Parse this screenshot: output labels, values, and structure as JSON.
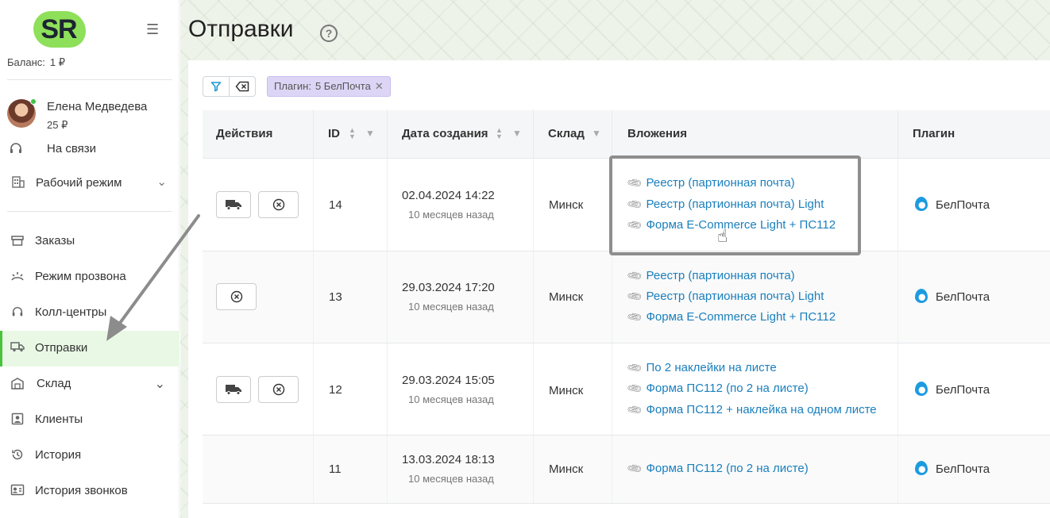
{
  "sidebar": {
    "logo_text": "SR",
    "balance_label": "Баланс:",
    "balance_value": "1 ₽",
    "user": {
      "name": "Елена Медведева",
      "amount": "25 ₽"
    },
    "status": "На связи",
    "mode": "Рабочий режим",
    "items": [
      {
        "label": "Заказы",
        "icon": "orders-icon"
      },
      {
        "label": "Режим прозвона",
        "icon": "dial-mode-icon"
      },
      {
        "label": "Колл-центры",
        "icon": "headset-icon"
      },
      {
        "label": "Отправки",
        "icon": "truck-icon",
        "active": true
      },
      {
        "label": "Склад",
        "icon": "warehouse-icon"
      },
      {
        "label": "Клиенты",
        "icon": "clients-icon"
      },
      {
        "label": "История",
        "icon": "history-icon"
      },
      {
        "label": "История звонков",
        "icon": "call-history-icon"
      }
    ]
  },
  "page": {
    "title": "Отправки",
    "help": "?"
  },
  "filter_chip": {
    "label": "Плагин:",
    "value": "5 БелПочта"
  },
  "table": {
    "columns": [
      "Действия",
      "ID",
      "Дата создания",
      "Склад",
      "Вложения",
      "Плагин"
    ],
    "rows": [
      {
        "id": "14",
        "date": "02.04.2024 14:22",
        "ago": "10 месяцев назад",
        "warehouse": "Минск",
        "attachments": [
          "Реестр (партионная почта)",
          "Реестр (партионная почта) Light",
          "Форма E-Commerce Light + ПС112"
        ],
        "plugin": "БелПочта"
      },
      {
        "id": "13",
        "date": "29.03.2024 17:20",
        "ago": "10 месяцев назад",
        "warehouse": "Минск",
        "attachments": [
          "Реестр (партионная почта)",
          "Реестр (партионная почта) Light",
          "Форма E-Commerce Light + ПС112"
        ],
        "plugin": "БелПочта"
      },
      {
        "id": "12",
        "date": "29.03.2024 15:05",
        "ago": "10 месяцев назад",
        "warehouse": "Минск",
        "attachments": [
          "По 2 наклейки на листе",
          "Форма ПС112 (по 2 на листе)",
          "Форма ПС112 + наклейка на одном листе"
        ],
        "plugin": "БелПочта"
      },
      {
        "id": "11",
        "date": "13.03.2024 18:13",
        "ago": "10 месяцев назад",
        "warehouse": "Минск",
        "attachments": [
          "Форма ПС112 (по 2 на листе)"
        ],
        "plugin": "БелПочта"
      }
    ]
  },
  "colors": {
    "accent_green": "#4ac23a",
    "link_blue": "#1a7fbd",
    "chip_bg": "#ddd5f5"
  }
}
